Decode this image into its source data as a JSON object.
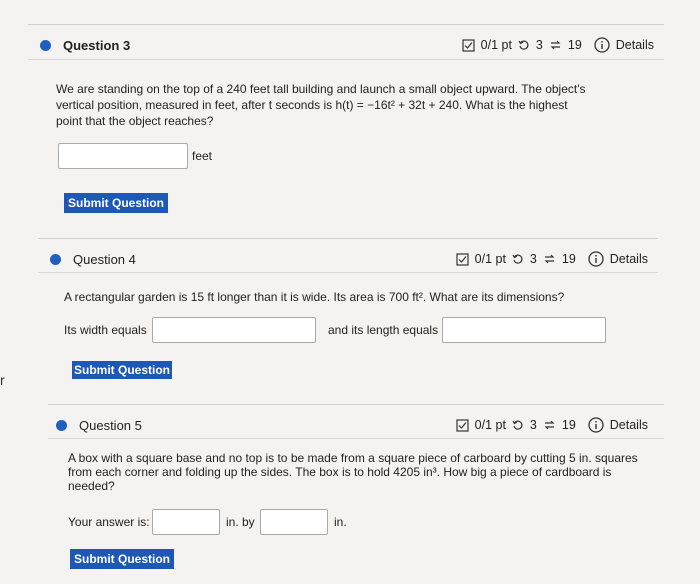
{
  "questions": [
    {
      "title": "Question 3",
      "points": "0/1 pt",
      "retries": "3",
      "attempts": "19",
      "details": "Details",
      "body_lines": [
        "We are standing on the top of a 240 feet tall building and launch a small object upward. The object's",
        "vertical position, measured in feet, after t seconds is h(t) = −16t² + 32t + 240.  What is the highest",
        "point that the object reaches?"
      ],
      "unit": "feet",
      "submit": "Submit Question"
    },
    {
      "title": "Question 4",
      "points": "0/1 pt",
      "retries": "3",
      "attempts": "19",
      "details": "Details",
      "body_lines": [
        "A rectangular garden is 15 ft longer than it is wide. Its area is 700 ft². What are its dimensions?"
      ],
      "width_label": "Its width equals",
      "length_label": "and its length equals",
      "submit": "Submit Question"
    },
    {
      "title": "Question 5",
      "points": "0/1 pt",
      "retries": "3",
      "attempts": "19",
      "details": "Details",
      "body_lines": [
        "A box with a square base and no top is to be made from a square piece of carboard by cutting 5 in. squares",
        "from each corner and folding up the sides. The box is to hold 4205 in³. How big a piece of cardboard is",
        "needed?"
      ],
      "answer_label": "Your answer is:",
      "by_label": "in. by",
      "in_label": "in.",
      "submit": "Submit Question"
    }
  ],
  "stray_char": "r",
  "colors": {
    "accent": "#1d58b6",
    "bullet": "#1f5fbf"
  },
  "icons": [
    "checkbox-icon",
    "retry-icon",
    "attempts-icon",
    "info-icon"
  ]
}
